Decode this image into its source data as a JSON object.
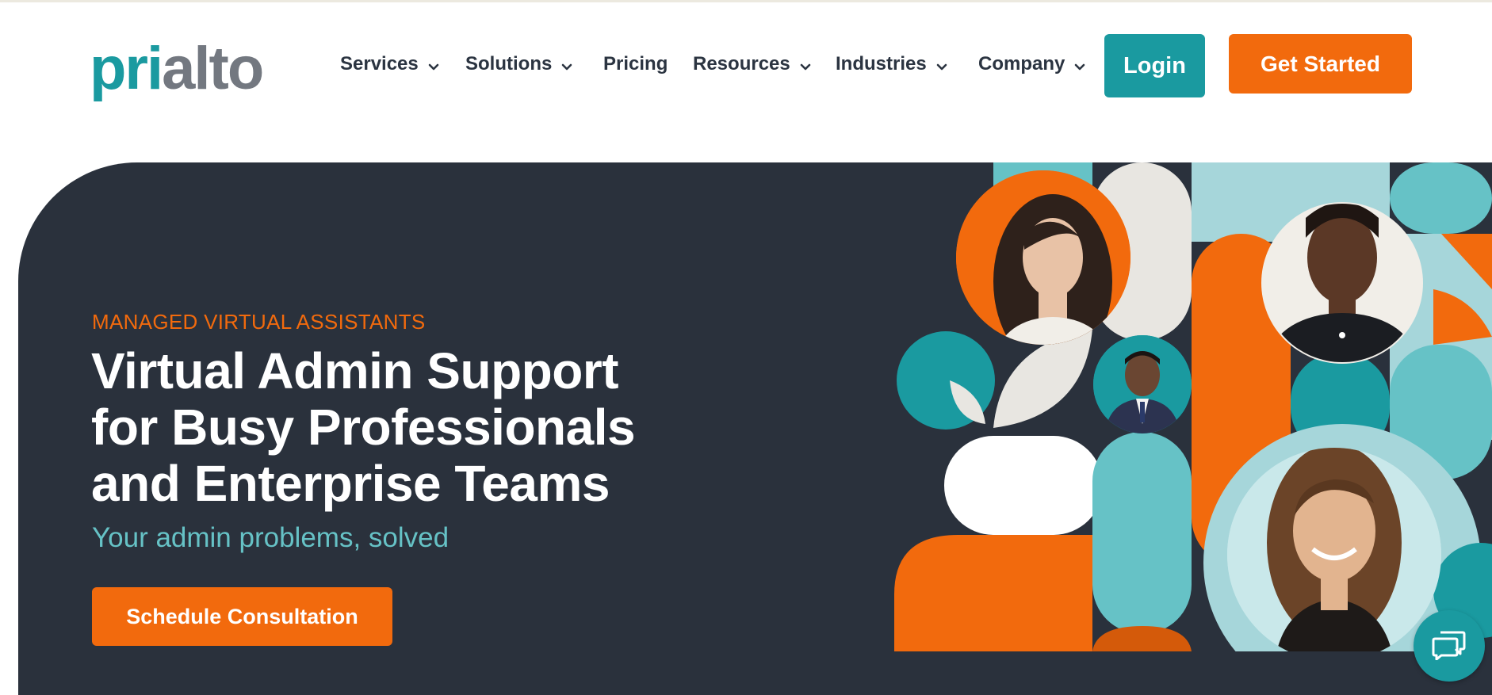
{
  "brand": {
    "logo_part1": "pri",
    "logo_part2": "alto",
    "primary_color": "#1a9aa0",
    "accent_color": "#f26a0d",
    "dark_color": "#2a313c"
  },
  "nav": {
    "items": [
      {
        "label": "Services",
        "has_dropdown": true
      },
      {
        "label": "Solutions",
        "has_dropdown": true
      },
      {
        "label": "Pricing",
        "has_dropdown": false
      },
      {
        "label": "Resources",
        "has_dropdown": true
      },
      {
        "label": "Industries",
        "has_dropdown": true
      },
      {
        "label": "Company",
        "has_dropdown": true
      }
    ],
    "login_label": "Login",
    "get_started_label": "Get Started",
    "chevron_icon": "chevron-down-icon"
  },
  "hero": {
    "eyebrow": "MANAGED VIRTUAL ASSISTANTS",
    "headline_line1": "Virtual Admin Support",
    "headline_line2": "for Busy Professionals",
    "headline_line3": "and Enterprise Teams",
    "subheadline": "Your admin problems, solved",
    "cta_label": "Schedule Consultation"
  },
  "collage": {
    "icon_names": [
      "person-photo-woman-dark-hair",
      "person-photo-woman-braids",
      "person-photo-man-suit",
      "person-photo-woman-long-hair"
    ]
  },
  "chat": {
    "icon": "chat-bubbles-icon"
  }
}
